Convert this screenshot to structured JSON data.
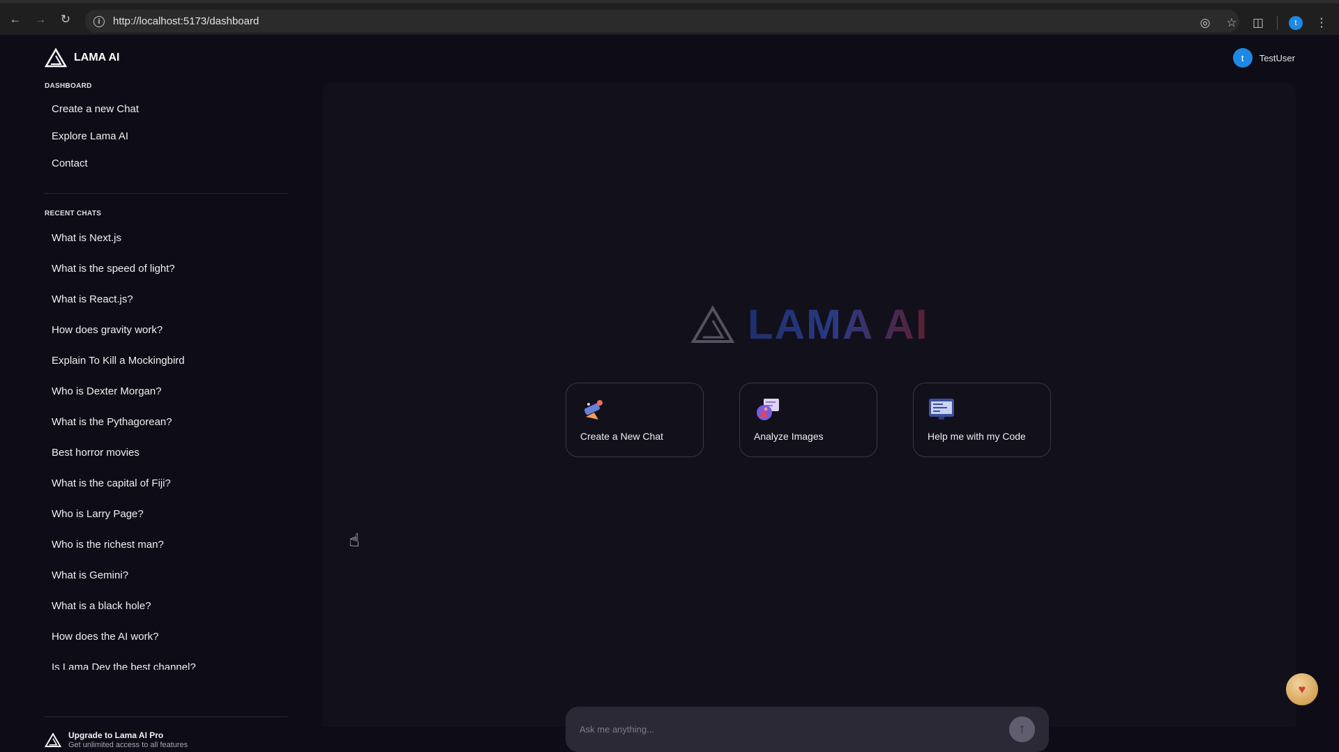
{
  "browser": {
    "url": "http://localhost:5173/dashboard",
    "profile_initial": "t"
  },
  "app": {
    "brand": "LAMA AI",
    "user": {
      "initial": "t",
      "name": "TestUser"
    }
  },
  "sidebar": {
    "dashboard_title": "DASHBOARD",
    "dashboard_links": [
      "Create a new Chat",
      "Explore Lama AI",
      "Contact"
    ],
    "recent_title": "RECENT CHATS",
    "recent_chats": [
      "What is Next.js",
      "What is the speed of light?",
      "What is React.js?",
      "How does gravity work?",
      "Explain To Kill a Mockingbird",
      "Who is Dexter Morgan?",
      "What is the Pythagorean?",
      "Best horror movies",
      "What is the capital of Fiji?",
      "Who is Larry Page?",
      "Who is the richest man?",
      "What is Gemini?",
      "What is a black hole?",
      "How does the AI work?",
      "Is Lama Dev the best channel?"
    ],
    "upgrade": {
      "title": "Upgrade to Lama AI Pro",
      "subtitle": "Get unlimited access to all features"
    }
  },
  "main": {
    "hero_title": "LAMA AI",
    "cards": [
      {
        "label": "Create a New Chat",
        "icon": "chat-icon"
      },
      {
        "label": "Analyze Images",
        "icon": "image-icon"
      },
      {
        "label": "Help me with my Code",
        "icon": "code-icon"
      }
    ],
    "input_placeholder": "Ask me anything..."
  },
  "colors": {
    "background": "#0e0c16",
    "panel": "#12101b",
    "input": "#2c2937",
    "accent_blue": "#1e88e5"
  }
}
